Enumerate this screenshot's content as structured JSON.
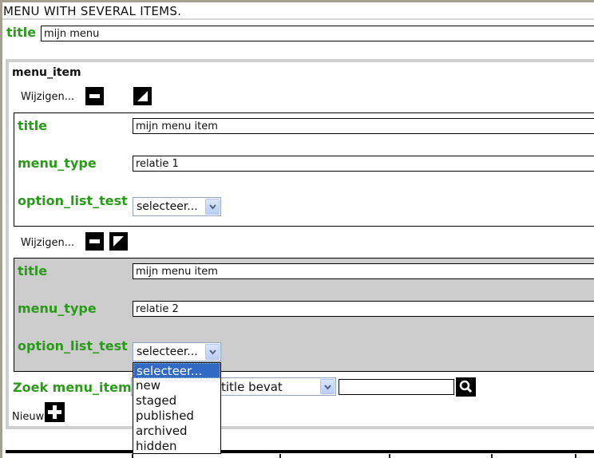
{
  "page": {
    "heading": "MENU WITH SEVERAL ITEMS."
  },
  "menu": {
    "title_label": "title",
    "title_value": "mijn menu"
  },
  "menu_item_section": {
    "heading": "menu_item",
    "items": [
      {
        "edit_label": "Wijzigen...",
        "fields": {
          "title_label": "title",
          "title_value": "mijn menu item",
          "menu_type_label": "menu_type",
          "menu_type_value": "relatie 1",
          "option_list_label": "option_list_test",
          "option_list_value": "selecteer..."
        }
      },
      {
        "edit_label": "Wijzigen...",
        "fields": {
          "title_label": "title",
          "title_value": "mijn menu item",
          "menu_type_label": "menu_type",
          "menu_type_value": "relatie 2",
          "option_list_label": "option_list_test",
          "option_list_value": "selecteer..."
        }
      }
    ],
    "dropdown_options": [
      "selecteer...",
      "new",
      "staged",
      "published",
      "archived",
      "hidden"
    ],
    "dropdown_selected": "selecteer...",
    "search": {
      "label": "Zoek menu_item",
      "criteria_value": "title bevat",
      "query_value": ""
    },
    "new_label": "Nieuw"
  },
  "icons": {
    "collapse": "minus-icon",
    "toggle": "corner-triangle-icon",
    "search": "magnifier-icon",
    "add": "plus-icon"
  },
  "colors": {
    "label_green": "#2a9a1a",
    "highlight_blue": "#316ac5",
    "panel_gray": "#cccccc"
  }
}
